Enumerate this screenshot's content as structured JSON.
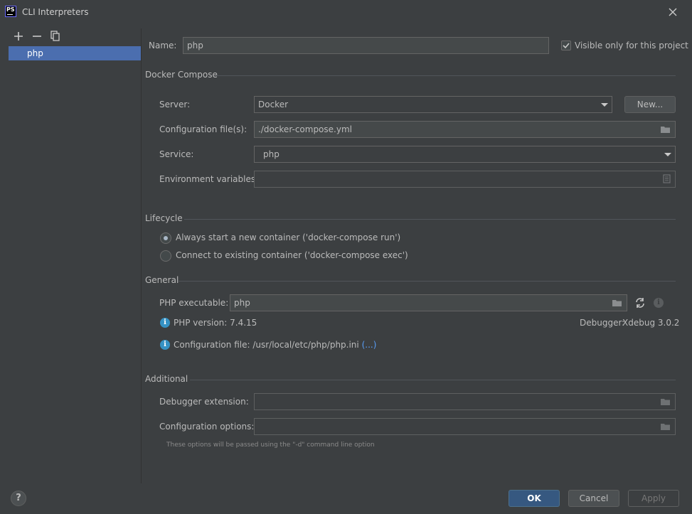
{
  "window": {
    "title": "CLI Interpreters",
    "app_logo_text": "PS"
  },
  "interpreters": [
    "php"
  ],
  "name_field": {
    "label": "Name:",
    "value": "php"
  },
  "visible_only": {
    "label": "Visible only for this project",
    "checked": true
  },
  "docker_compose": {
    "section": "Docker Compose",
    "server_label": "Server:",
    "server_value": "Docker",
    "new_button": "New...",
    "config_label": "Configuration file(s):",
    "config_value": "./docker-compose.yml",
    "service_label": "Service:",
    "service_value": "php",
    "env_label": "Environment variables:",
    "env_value": ""
  },
  "lifecycle": {
    "section": "Lifecycle",
    "option_run": "Always start a new container ('docker-compose run')",
    "option_exec": "Connect to existing container ('docker-compose exec')",
    "selected": "run"
  },
  "general": {
    "section": "General",
    "php_exec_label": "PHP executable:",
    "php_exec_value": "php",
    "php_version": "PHP version: 7.4.15",
    "debugger_label": "Debugger:",
    "debugger_value": "Xdebug 3.0.2",
    "config_file": "Configuration file: /usr/local/etc/php/php.ini",
    "config_file_more": "(...)"
  },
  "additional": {
    "section": "Additional",
    "debugger_ext_label": "Debugger extension:",
    "debugger_ext_value": "",
    "config_opts_label": "Configuration options:",
    "config_opts_value": "",
    "hint": "These options will be passed using the \"-d\" command line option"
  },
  "footer": {
    "help": "?",
    "ok": "OK",
    "cancel": "Cancel",
    "apply": "Apply"
  },
  "colors": {
    "background": "#3c3f41",
    "selection": "#4b6eaf",
    "primary_button": "#365880",
    "info": "#3592c4",
    "link": "#589df6"
  }
}
